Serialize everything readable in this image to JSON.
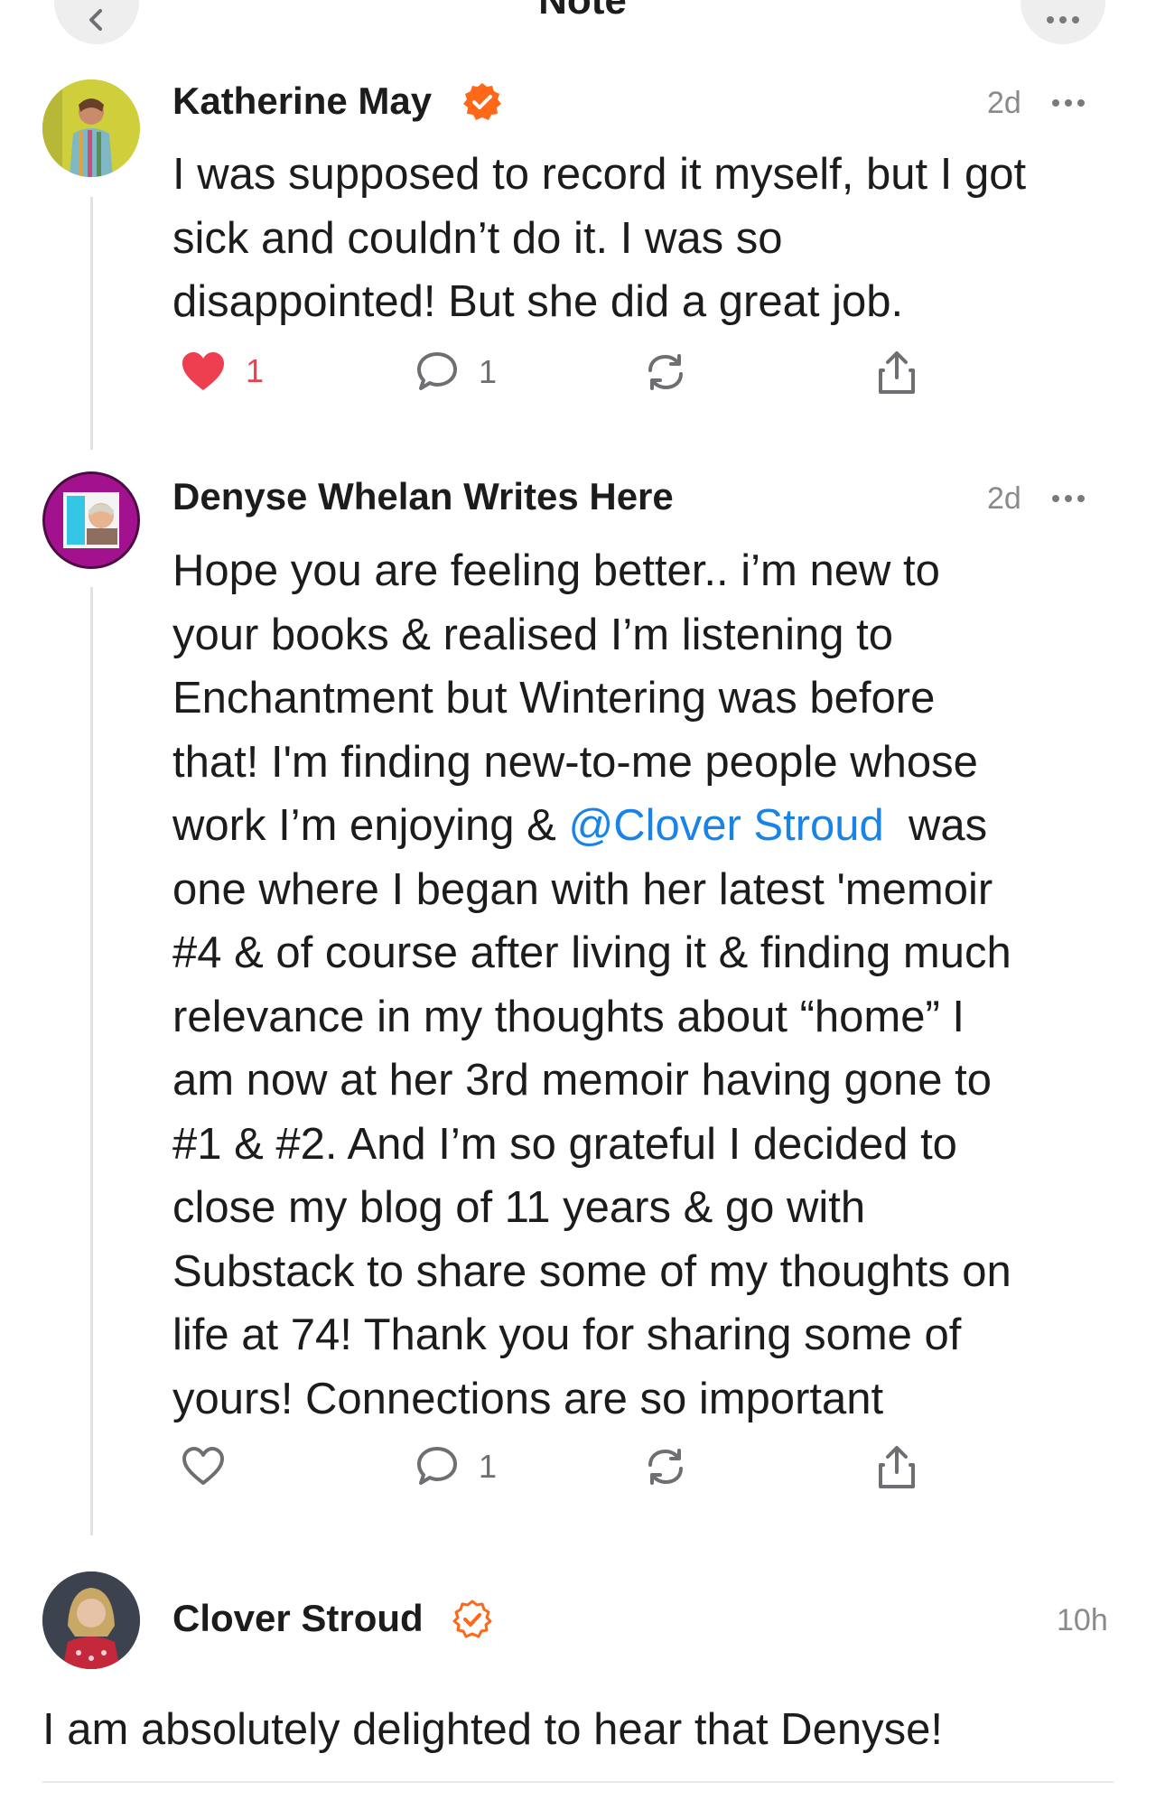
{
  "header": {
    "title": "Note"
  },
  "comments": [
    {
      "author": "Katherine May",
      "verified": true,
      "time": "2d",
      "lines": [
        "I was supposed to record it myself, but I got",
        "sick and couldn’t do it. I was so",
        "disappointed! But she did a great job."
      ],
      "likes": "1",
      "liked": true,
      "replies": "1"
    },
    {
      "author": "Denyse Whelan Writes Here",
      "verified": false,
      "time": "2d",
      "lines_before_mention": [
        "Hope you are feeling better.. i’m new to",
        "your books & realised I’m listening to",
        "Enchantment but Wintering was before",
        "that! I'm finding new-to-me people whose"
      ],
      "mention_line_prefix": "work I’m enjoying & ",
      "mention": "@Clover Stroud",
      "mention_line_suffix": "  was",
      "lines_after_mention": [
        "one where I began with her latest 'memoir",
        "#4 & of course after living it & finding much",
        "relevance in my thoughts about “home” I",
        "am now at her 3rd memoir having gone to",
        "#1 & #2. And I’m so grateful I decided to",
        "close my blog of 11 years & go with",
        "Substack to share some of my thoughts on",
        "life at 74! Thank you for sharing some of",
        "yours! Connections are so important"
      ],
      "likes": "",
      "liked": false,
      "replies": "1"
    },
    {
      "author": "Clover Stroud",
      "verified": true,
      "time": "10h",
      "lines": [
        "I am absolutely delighted to hear that Denyse!"
      ]
    }
  ],
  "colors": {
    "accent": "#ff6719",
    "like": "#ee3f50",
    "mention": "#1a84e6"
  },
  "icons": [
    "back-chevron-icon",
    "more-icon",
    "verified-badge-icon",
    "heart-icon",
    "comment-icon",
    "restack-icon",
    "share-icon"
  ]
}
